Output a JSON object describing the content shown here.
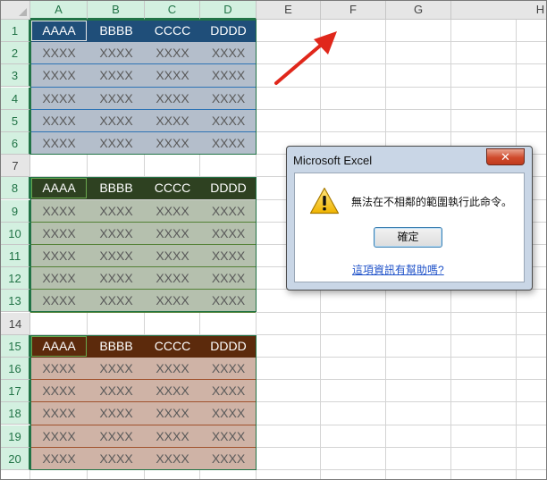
{
  "columns": [
    "A",
    "B",
    "C",
    "D",
    "E",
    "F",
    "G",
    "H"
  ],
  "rows": [
    "1",
    "2",
    "3",
    "4",
    "5",
    "6",
    "7",
    "8",
    "9",
    "10",
    "11",
    "12",
    "13",
    "14",
    "15",
    "16",
    "17",
    "18",
    "19",
    "20"
  ],
  "tables": [
    {
      "header": [
        "AAAA",
        "BBBB",
        "CCCC",
        "DDDD"
      ],
      "body_row": [
        "XXXX",
        "XXXX",
        "XXXX",
        "XXXX"
      ],
      "header_color": "#1f4e79",
      "body_color": "#b4becb",
      "line_color": "#2e74b5"
    },
    {
      "header": [
        "AAAA",
        "BBBB",
        "CCCC",
        "DDDD"
      ],
      "body_row": [
        "XXXX",
        "XXXX",
        "XXXX",
        "XXXX"
      ],
      "header_color": "#2e4121",
      "body_color": "#b5c0ae",
      "line_color": "#538135"
    },
    {
      "header": [
        "AAAA",
        "BBBB",
        "CCCC",
        "DDDD"
      ],
      "body_row": [
        "XXXX",
        "XXXX",
        "XXXX",
        "XXXX"
      ],
      "header_color": "#5c2a0c",
      "body_color": "#cfb3a6",
      "line_color": "#a0522d"
    }
  ],
  "dialog": {
    "title": "Microsoft Excel",
    "close_label": "✕",
    "message": "無法在不相鄰的範圍執行此命令。",
    "ok_label": "確定",
    "help_link": "這項資訊有幫助嗎?"
  },
  "colors": {
    "selection": "#217346",
    "arrow": "#e0271b"
  }
}
